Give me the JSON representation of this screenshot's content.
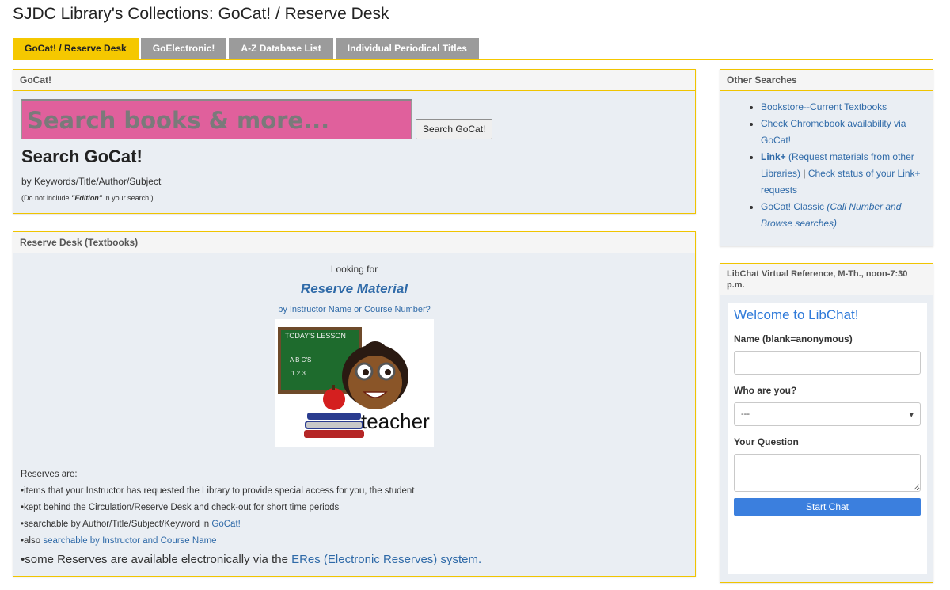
{
  "page": {
    "title": "SJDC Library's Collections: GoCat! / Reserve Desk"
  },
  "tabs": [
    {
      "label": "GoCat! / Reserve Desk",
      "active": true
    },
    {
      "label": "GoElectronic!",
      "active": false
    },
    {
      "label": "A-Z Database List",
      "active": false
    },
    {
      "label": "Individual Periodical Titles",
      "active": false
    }
  ],
  "gocat": {
    "panel_title": "GoCat!",
    "search_placeholder": "Search books & more...",
    "search_button": "Search GoCat!",
    "heading": "Search GoCat!",
    "subtext": "by Keywords/Title/Author/Subject",
    "note_prefix": "(Do not include ",
    "note_bold": "\"Edition\"",
    "note_suffix": " in your search.)"
  },
  "reserve": {
    "panel_title": "Reserve Desk (Textbooks)",
    "looking": "Looking for",
    "link": "Reserve Material",
    "by_instructor": "by Instructor Name or Course Number?",
    "image_text": {
      "lesson": "TODAY'S LESSON",
      "abc": "A B C'S",
      "nums": "1 2 3",
      "word": "teacher"
    },
    "list_intro": "Reserves are:",
    "item1": "•items that your Instructor has requested the Library to provide special access for you, the student",
    "item2": "•kept behind the Circulation/Reserve Desk and check-out for short time periods",
    "item3_prefix": "•searchable by Author/Title/Subject/Keyword in ",
    "item3_link": "GoCat!",
    "item4_prefix": "•also ",
    "item4_link": "searchable by Instructor and Course Name",
    "item5_prefix": "•some Reserves are available electronically via the ",
    "item5_link": "ERes (Electronic Reserves) system."
  },
  "other": {
    "panel_title": "Other Searches",
    "item1": "Bookstore--Current Textbooks",
    "item2": "Check Chromebook availability via GoCat!",
    "item3_bold": "Link+",
    "item3_rest": " (Request materials from other Libraries)",
    "item3_sep": " | ",
    "item3_link2": "Check status of your Link+ requests",
    "item4_link": "GoCat! Classic ",
    "item4_italic": "(Call Number and Browse searches)"
  },
  "libchat": {
    "panel_title": "LibChat Virtual Reference, M-Th., noon-7:30 p.m.",
    "welcome": "Welcome to LibChat!",
    "name_label": "Name (blank=anonymous)",
    "who_label": "Who are you?",
    "who_value": "---",
    "question_label": "Your Question",
    "start_button": "Start Chat"
  },
  "colors": {
    "accent": "#f5c800",
    "tab_inactive": "#9b9b9b",
    "search_bg": "#e0609c",
    "link": "#2f6aa8",
    "chat_button": "#3b7fde"
  }
}
